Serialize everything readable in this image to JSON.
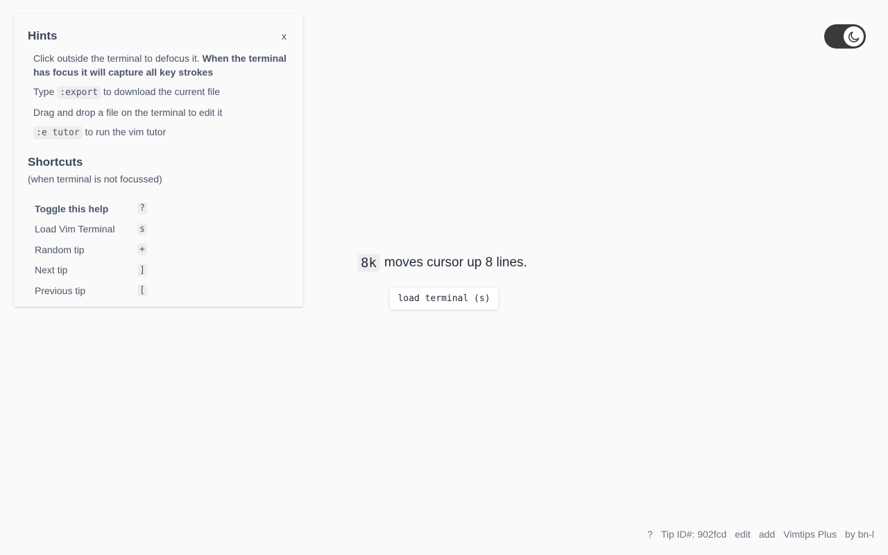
{
  "hints": {
    "title": "Hints",
    "close_label": "x",
    "items": [
      {
        "text_before": "Click outside the terminal to defocus it. ",
        "bold": "When the terminal has focus it will capture all key strokes"
      },
      {
        "text_before": "Type ",
        "code": ":export",
        "text_after": " to download the current file"
      },
      {
        "text": "Drag and drop a file on the terminal to edit it"
      },
      {
        "code": ":e tutor",
        "text_after": " to run the vim tutor"
      }
    ]
  },
  "shortcuts": {
    "title": "Shortcuts",
    "subtitle": "(when terminal is not focussed)",
    "rows": [
      {
        "label": "Toggle this help",
        "key": "?"
      },
      {
        "label": "Load Vim Terminal",
        "key": "s"
      },
      {
        "label": "Random tip",
        "key": "+"
      },
      {
        "label": "Next tip",
        "key": "]"
      },
      {
        "label": "Previous tip",
        "key": "["
      }
    ]
  },
  "theme_toggle": {
    "icon": "moon-icon",
    "state": "dark"
  },
  "tip": {
    "code": "8k",
    "text": "moves cursor up 8 lines."
  },
  "load_button": {
    "label": "load terminal (s)"
  },
  "footer": {
    "help": "?",
    "tip_id": "Tip ID#: 902fcd",
    "edit": "edit",
    "add": "add",
    "plus": "Vimtips Plus",
    "by": "by bn-l"
  }
}
